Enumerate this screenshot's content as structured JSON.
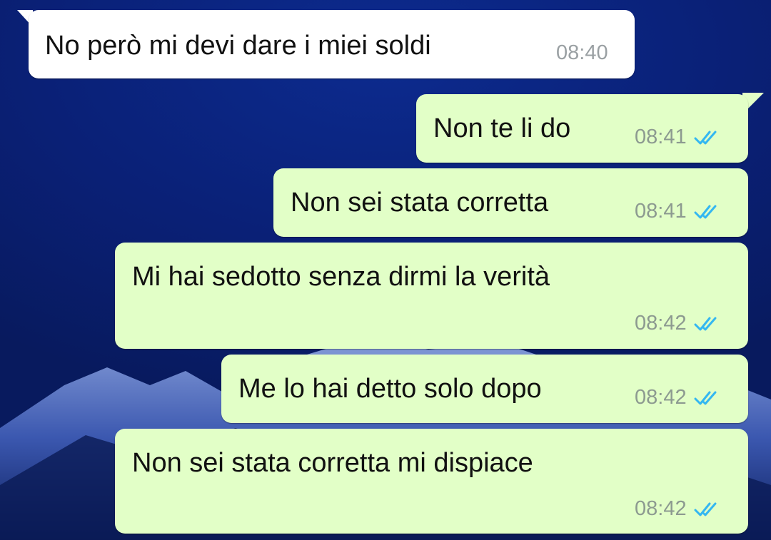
{
  "messages": [
    {
      "direction": "incoming",
      "text": "No però mi devi dare i miei soldi",
      "time": "08:40"
    },
    {
      "direction": "outgoing",
      "text": "Non te li do",
      "time": "08:41",
      "status": "read"
    },
    {
      "direction": "outgoing",
      "text": "Non sei stata corretta",
      "time": "08:41",
      "status": "read"
    },
    {
      "direction": "outgoing",
      "text": "Mi hai sedotto senza dirmi la verità",
      "time": "08:42",
      "status": "read"
    },
    {
      "direction": "outgoing",
      "text": "Me lo hai detto solo dopo",
      "time": "08:42",
      "status": "read"
    },
    {
      "direction": "outgoing",
      "text": "Non sei stata corretta mi dispiace",
      "time": "08:42",
      "status": "read"
    }
  ],
  "colors": {
    "incoming_bubble": "#ffffff",
    "outgoing_bubble": "#e2ffc7",
    "read_tick": "#34b7f1",
    "wallpaper": "#0a2076"
  },
  "icons": {
    "read_receipt": "double-check-icon"
  }
}
